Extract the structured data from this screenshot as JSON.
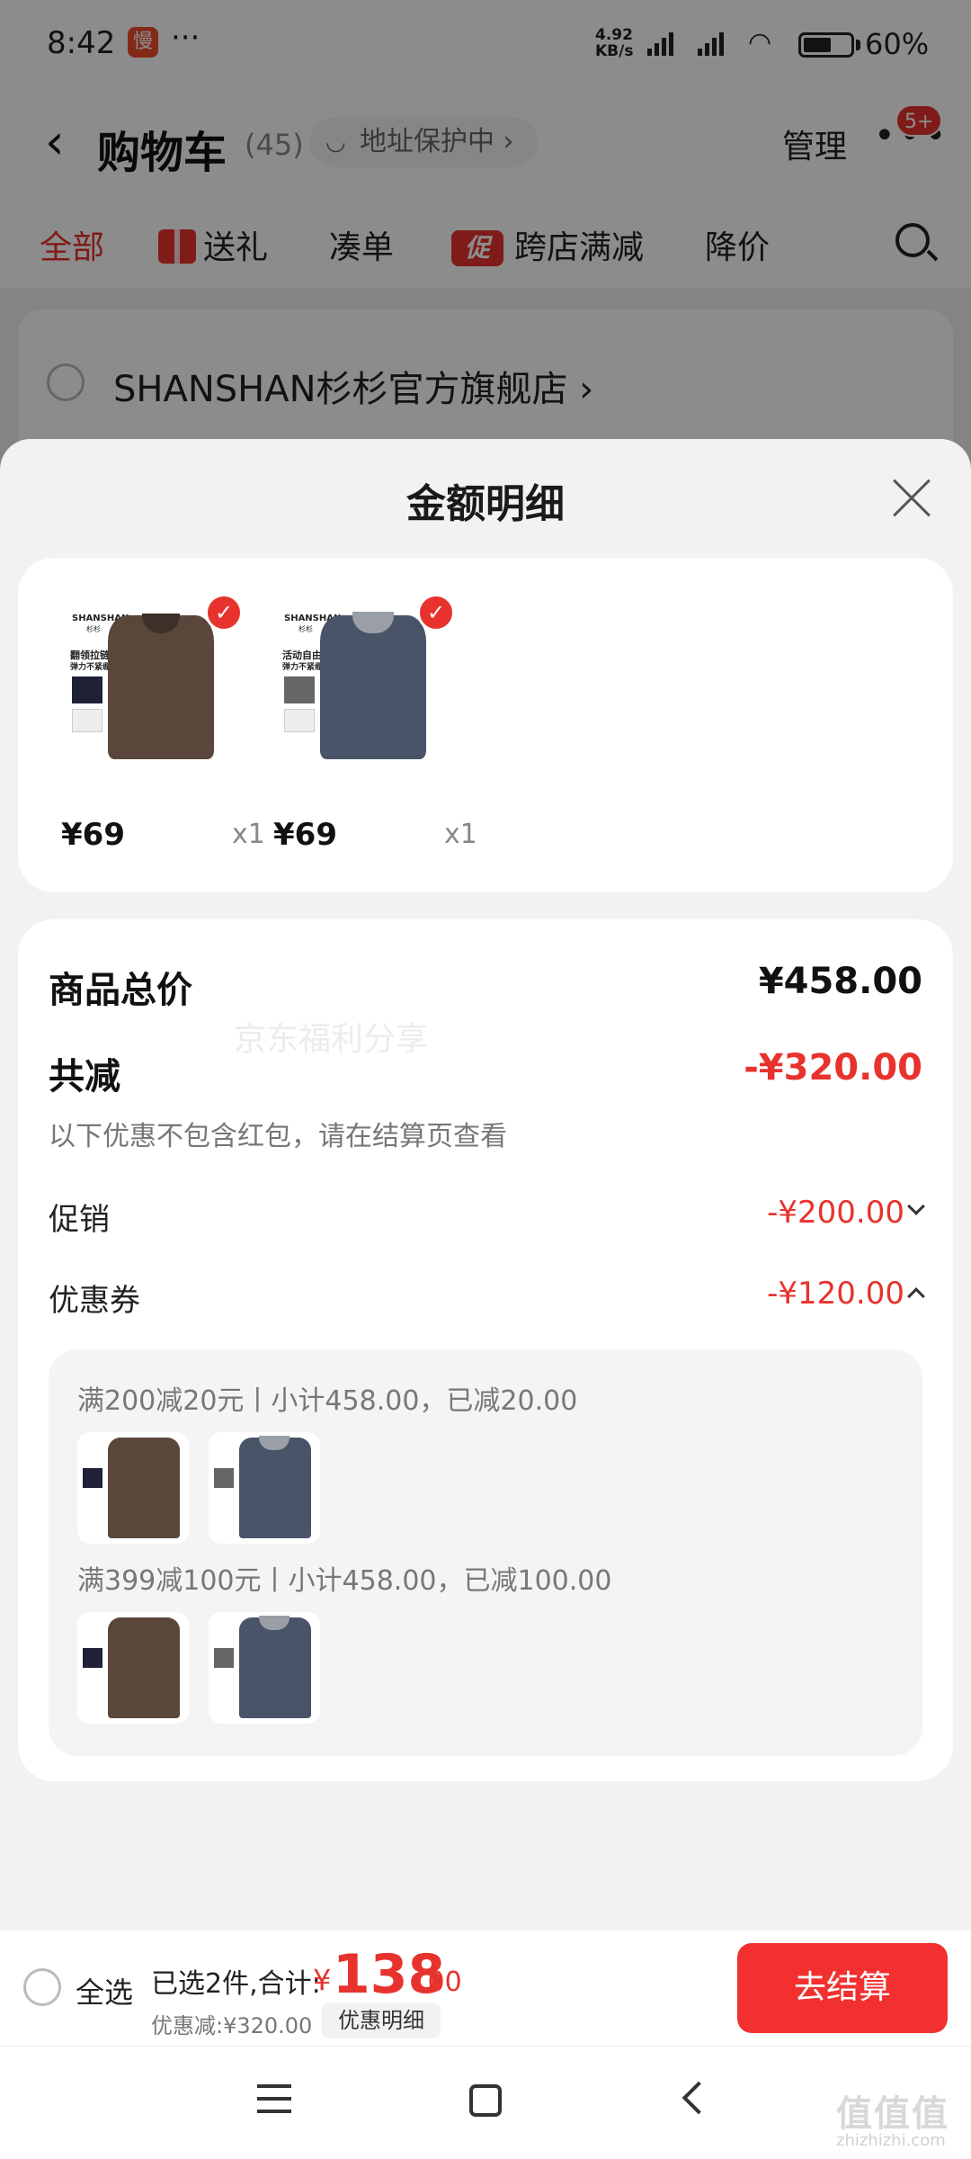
{
  "status_bar": {
    "time": "8:42",
    "app_badge": "慢",
    "more": "···",
    "net_speed_value": "4.92",
    "net_speed_unit": "KB/s",
    "battery_percent": "60%",
    "battery_level": 0.6
  },
  "header": {
    "back_icon": "chevron-left-icon",
    "title": "购物车",
    "count": "(45)",
    "address_protect": "地址保护中 ›",
    "manage": "管理",
    "more_icon": "more-dots-icon",
    "message_badge": "5+"
  },
  "tabs": [
    {
      "label": "全部",
      "active": true
    },
    {
      "label": "送礼",
      "icon": "gift-icon"
    },
    {
      "label": "凑单"
    },
    {
      "label": "跨店满减",
      "icon_text": "促"
    },
    {
      "label": "降价"
    }
  ],
  "search_icon": "search-icon",
  "store": {
    "name": "SHANSHAN杉杉官方旗舰店 ›"
  },
  "sheet": {
    "title": "金额明细",
    "close_icon": "close-icon",
    "items": [
      {
        "price": "¥69",
        "qty": "x1",
        "color": "#5a463a",
        "brand": "SHANSHAN",
        "brand_sub": "杉杉",
        "tag1": "翻领拉链",
        "tag2": "弹力不紧绷"
      },
      {
        "price": "¥69",
        "qty": "x1",
        "color": "#4a5468",
        "brand": "SHANSHAN",
        "brand_sub": "杉杉",
        "tag1": "活动自由",
        "tag2": "弹力不紧绷"
      }
    ],
    "summary": {
      "total_label": "商品总价",
      "total_value": "¥458.00",
      "reduce_label": "共减",
      "reduce_value": "-¥320.00",
      "note": "以下优惠不包含红包，请在结算页查看",
      "watermark": "京东福利分享",
      "promo_label": "促销",
      "promo_value": "-¥200.00",
      "coupon_label": "优惠券",
      "coupon_value": "-¥120.00"
    },
    "coupons": [
      {
        "rule": "满200减20元丨小计458.00，已减20.00"
      },
      {
        "rule": "满399减100元丨小计458.00，已减100.00"
      }
    ]
  },
  "bottom_bar": {
    "select_all": "全选",
    "selected_text": "已选2件,合计:",
    "currency": "¥",
    "total_int": "138",
    "total_dec": ".00",
    "discount_text": "优惠减:¥320.00",
    "detail_button": "优惠明细",
    "checkout": "去结算"
  },
  "watermark": {
    "main": "值值值",
    "sub": "zhizhizhi.com"
  },
  "colors": {
    "accent": "#e8322d",
    "checkout": "#f23030"
  }
}
